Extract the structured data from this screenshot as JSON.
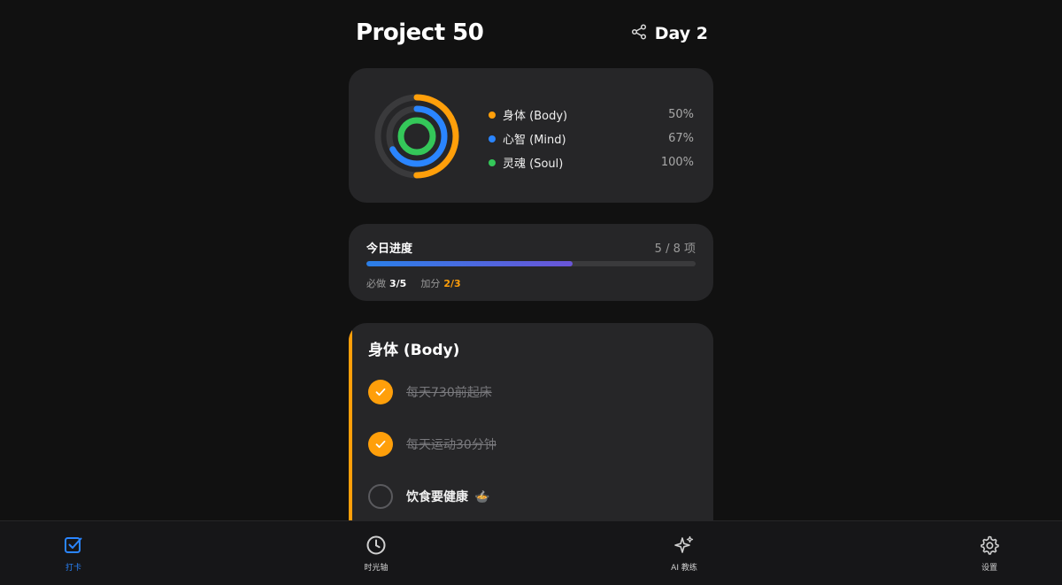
{
  "header": {
    "title": "Project 50",
    "share_icon": "share-icon",
    "day": "Day 2"
  },
  "rings": {
    "items": [
      {
        "label": "身体 (Body)",
        "percent": "50%",
        "value": 0.5,
        "color": "#ff9f0a"
      },
      {
        "label": "心智 (Mind)",
        "percent": "67%",
        "value": 0.67,
        "color": "#2a85ff"
      },
      {
        "label": "灵魂 (Soul)",
        "percent": "100%",
        "value": 1.0,
        "color": "#34c759"
      }
    ]
  },
  "progress": {
    "title": "今日进度",
    "count": "5 / 8 项",
    "fraction": 0.625,
    "required_label": "必做",
    "required_value": "3/5",
    "bonus_label": "加分",
    "bonus_value": "2/3"
  },
  "body_section": {
    "title": "身体 (Body)",
    "accent_color": "#ff9f0a",
    "tasks": [
      {
        "label": "每天730前起床",
        "done": true
      },
      {
        "label": "每天运动30分钟",
        "done": true
      },
      {
        "label": "饮食要健康",
        "emoji": "🍲",
        "done": false
      }
    ]
  },
  "tabs": [
    {
      "label": "打卡",
      "icon": "checkbox-icon",
      "active": true
    },
    {
      "label": "时光轴",
      "icon": "clock-icon",
      "active": false
    },
    {
      "label": "AI 教练",
      "icon": "sparkles-icon",
      "active": false
    },
    {
      "label": "设置",
      "icon": "gear-icon",
      "active": false
    }
  ]
}
